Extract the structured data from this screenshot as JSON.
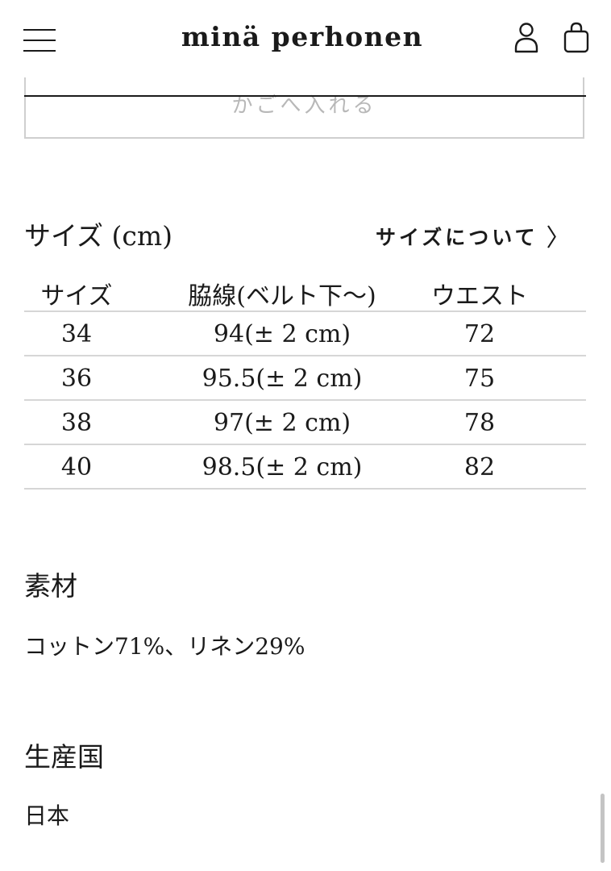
{
  "header": {
    "logo": "minä perhonen",
    "menu_icon": "hamburger-menu-icon",
    "account_icon": "user-icon",
    "cart_icon": "shopping-bag-icon"
  },
  "cart_button": {
    "label": "かごへ入れる"
  },
  "size_section": {
    "title": "サイズ (cm)",
    "guide_link": "サイズについて",
    "guide_icon": "chevron-right-icon",
    "columns": [
      "サイズ",
      "脇線(ベルト下〜)",
      "ウエスト"
    ],
    "rows": [
      [
        "34",
        "94(± 2 cm)",
        "72"
      ],
      [
        "36",
        "95.5(± 2 cm)",
        "75"
      ],
      [
        "38",
        "97(± 2 cm)",
        "78"
      ],
      [
        "40",
        "98.5(± 2 cm)",
        "82"
      ]
    ]
  },
  "material": {
    "title": "素材",
    "value": "コットン71%、リネン29%"
  },
  "origin": {
    "title": "生産国",
    "value": "日本"
  }
}
